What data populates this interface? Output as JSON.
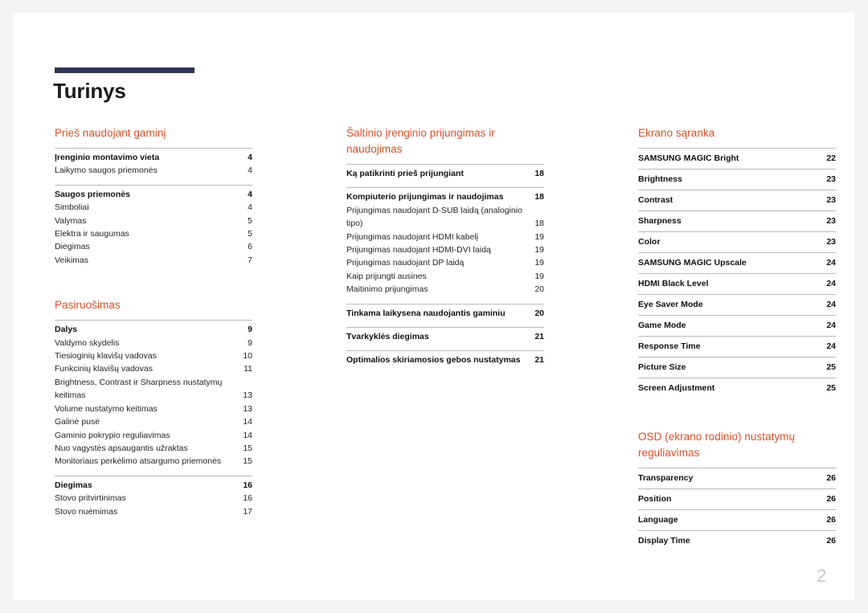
{
  "document": {
    "title": "Turinys",
    "page_number": "2",
    "accent_color": "#e04e2a",
    "rule_color": "#2e3550"
  },
  "columns": [
    {
      "id": "column-1",
      "sections": [
        {
          "heading": "Prieš naudojant gaminį",
          "groups": [
            {
              "entries": [
                {
                  "label": "Įrenginio montavimo vieta",
                  "page": "4",
                  "bold": true
                },
                {
                  "label": "Laikymo saugos priemonės",
                  "page": "4",
                  "bold": false
                }
              ]
            },
            {
              "entries": [
                {
                  "label": "Saugos priemonės",
                  "page": "4",
                  "bold": true
                },
                {
                  "label": "Simboliai",
                  "page": "4",
                  "bold": false
                },
                {
                  "label": "Valymas",
                  "page": "5",
                  "bold": false
                },
                {
                  "label": "Elektra ir saugumas",
                  "page": "5",
                  "bold": false
                },
                {
                  "label": "Diegimas",
                  "page": "6",
                  "bold": false
                },
                {
                  "label": "Veikimas",
                  "page": "7",
                  "bold": false
                }
              ]
            }
          ]
        },
        {
          "heading": "Pasiruošimas",
          "groups": [
            {
              "entries": [
                {
                  "label": "Dalys",
                  "page": "9",
                  "bold": true
                },
                {
                  "label": "Valdymo skydelis",
                  "page": "9",
                  "bold": false
                },
                {
                  "label": "Tiesioginių klavišų vadovas",
                  "page": "10",
                  "bold": false
                },
                {
                  "label": "Funkcinių klavišų vadovas",
                  "page": "11",
                  "bold": false
                },
                {
                  "label": "Brightness, Contrast ir Sharpness nustatymų keitimas",
                  "page": "13",
                  "bold": false
                },
                {
                  "label": "Volume nustatymo keitimas",
                  "page": "13",
                  "bold": false
                },
                {
                  "label": "Galinė pusė",
                  "page": "14",
                  "bold": false
                },
                {
                  "label": "Gaminio pokrypio reguliavimas",
                  "page": "14",
                  "bold": false
                },
                {
                  "label": "Nuo vagystės apsaugantis užraktas",
                  "page": "15",
                  "bold": false
                },
                {
                  "label": "Monitoriaus perkėlimo atsargumo priemonės",
                  "page": "15",
                  "bold": false
                }
              ]
            },
            {
              "entries": [
                {
                  "label": "Diegimas",
                  "page": "16",
                  "bold": true
                },
                {
                  "label": "Stovo pritvirtinimas",
                  "page": "16",
                  "bold": false
                },
                {
                  "label": "Stovo nuėmimas",
                  "page": "17",
                  "bold": false
                }
              ]
            }
          ]
        }
      ]
    },
    {
      "id": "column-2",
      "sections": [
        {
          "heading": "Šaltinio įrenginio prijungimas ir naudojimas",
          "groups": [
            {
              "entries": [
                {
                  "label": "Ką patikrinti prieš prijungiant",
                  "page": "18",
                  "bold": true
                }
              ]
            },
            {
              "entries": [
                {
                  "label": "Kompiuterio prijungimas ir naudojimas",
                  "page": "18",
                  "bold": true
                },
                {
                  "label": "Prijungimas naudojant D-SUB laidą (analoginio tipo)",
                  "page": "18",
                  "bold": false
                },
                {
                  "label": "Prijungimas naudojant HDMI kabelį",
                  "page": "19",
                  "bold": false
                },
                {
                  "label": "Prijungimas naudojant HDMI-DVI laidą",
                  "page": "19",
                  "bold": false
                },
                {
                  "label": "Prijungimas naudojant DP laidą",
                  "page": "19",
                  "bold": false
                },
                {
                  "label": "Kaip prijungti ausines",
                  "page": "19",
                  "bold": false
                },
                {
                  "label": "Maitinimo prijungimas",
                  "page": "20",
                  "bold": false
                }
              ]
            },
            {
              "entries": [
                {
                  "label": "Tinkama laikysena naudojantis gaminiu",
                  "page": "20",
                  "bold": true
                }
              ]
            },
            {
              "entries": [
                {
                  "label": "Tvarkyklės diegimas",
                  "page": "21",
                  "bold": true
                }
              ]
            },
            {
              "entries": [
                {
                  "label": "Optimalios skiriamosios gebos nustatymas",
                  "page": "21",
                  "bold": true
                }
              ]
            }
          ]
        }
      ]
    },
    {
      "id": "column-3",
      "sections": [
        {
          "heading": "Ekrano sąranka",
          "rows": [
            {
              "label": "SAMSUNG MAGIC Bright",
              "page": "22"
            },
            {
              "label": "Brightness",
              "page": "23"
            },
            {
              "label": "Contrast",
              "page": "23"
            },
            {
              "label": "Sharpness",
              "page": "23"
            },
            {
              "label": "Color",
              "page": "23"
            },
            {
              "label": "SAMSUNG MAGIC Upscale",
              "page": "24"
            },
            {
              "label": "HDMI Black Level",
              "page": "24"
            },
            {
              "label": "Eye Saver Mode",
              "page": "24"
            },
            {
              "label": "Game Mode",
              "page": "24"
            },
            {
              "label": "Response Time",
              "page": "24"
            },
            {
              "label": "Picture Size",
              "page": "25"
            },
            {
              "label": "Screen Adjustment",
              "page": "25"
            }
          ]
        },
        {
          "heading": "OSD (ekrano rodinio) nustatymų reguliavimas",
          "rows": [
            {
              "label": "Transparency",
              "page": "26"
            },
            {
              "label": "Position",
              "page": "26"
            },
            {
              "label": "Language",
              "page": "26"
            },
            {
              "label": "Display Time",
              "page": "26"
            }
          ]
        }
      ]
    }
  ]
}
